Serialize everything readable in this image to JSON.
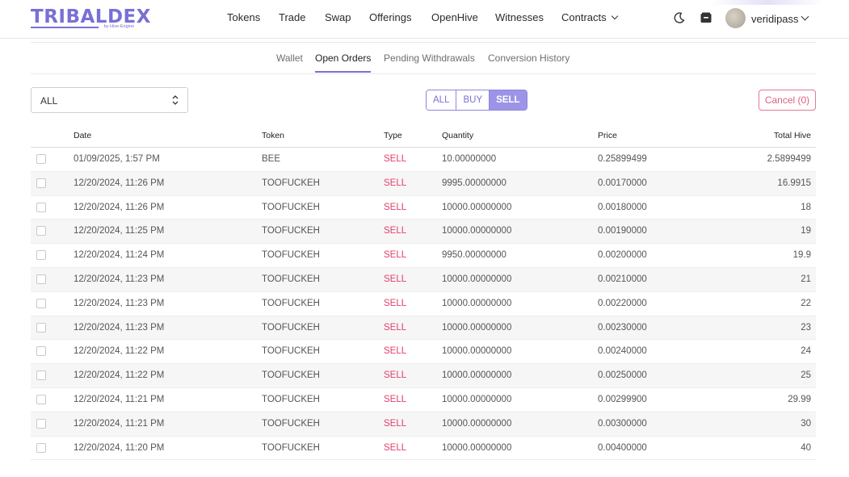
{
  "brand": {
    "name": "TRIBALDEX",
    "subtitle": "by Hive-Engine"
  },
  "nav": {
    "items": [
      "Tokens",
      "Trade",
      "Swap",
      "Offerings",
      "OpenHive",
      "Witnesses",
      "Contracts"
    ],
    "username": "veridipass"
  },
  "subtabs": [
    "Wallet",
    "Open Orders",
    "Pending Withdrawals",
    "Conversion History"
  ],
  "active_subtab": "Open Orders",
  "controls": {
    "token_select": "ALL",
    "filters": [
      "ALL",
      "BUY",
      "SELL"
    ],
    "active_filter": "SELL",
    "cancel_label": "Cancel (0)"
  },
  "table": {
    "headers": [
      "Date",
      "Token",
      "Type",
      "Quantity",
      "Price",
      "Total Hive"
    ],
    "rows": [
      [
        "01/09/2025, 1:57 PM",
        "BEE",
        "SELL",
        "10.00000000",
        "0.25899499",
        "2.5899499"
      ],
      [
        "12/20/2024, 11:26 PM",
        "TOOFUCKEH",
        "SELL",
        "9995.00000000",
        "0.00170000",
        "16.9915"
      ],
      [
        "12/20/2024, 11:26 PM",
        "TOOFUCKEH",
        "SELL",
        "10000.00000000",
        "0.00180000",
        "18"
      ],
      [
        "12/20/2024, 11:25 PM",
        "TOOFUCKEH",
        "SELL",
        "10000.00000000",
        "0.00190000",
        "19"
      ],
      [
        "12/20/2024, 11:24 PM",
        "TOOFUCKEH",
        "SELL",
        "9950.00000000",
        "0.00200000",
        "19.9"
      ],
      [
        "12/20/2024, 11:23 PM",
        "TOOFUCKEH",
        "SELL",
        "10000.00000000",
        "0.00210000",
        "21"
      ],
      [
        "12/20/2024, 11:23 PM",
        "TOOFUCKEH",
        "SELL",
        "10000.00000000",
        "0.00220000",
        "22"
      ],
      [
        "12/20/2024, 11:23 PM",
        "TOOFUCKEH",
        "SELL",
        "10000.00000000",
        "0.00230000",
        "23"
      ],
      [
        "12/20/2024, 11:22 PM",
        "TOOFUCKEH",
        "SELL",
        "10000.00000000",
        "0.00240000",
        "24"
      ],
      [
        "12/20/2024, 11:22 PM",
        "TOOFUCKEH",
        "SELL",
        "10000.00000000",
        "0.00250000",
        "25"
      ],
      [
        "12/20/2024, 11:21 PM",
        "TOOFUCKEH",
        "SELL",
        "10000.00000000",
        "0.00299900",
        "29.99"
      ],
      [
        "12/20/2024, 11:21 PM",
        "TOOFUCKEH",
        "SELL",
        "10000.00000000",
        "0.00300000",
        "30"
      ],
      [
        "12/20/2024, 11:20 PM",
        "TOOFUCKEH",
        "SELL",
        "10000.00000000",
        "0.00400000",
        "40"
      ]
    ]
  },
  "colors": {
    "accent": "#7a6fd6",
    "sell": "#e2406a",
    "cancel": "#e0607f"
  }
}
